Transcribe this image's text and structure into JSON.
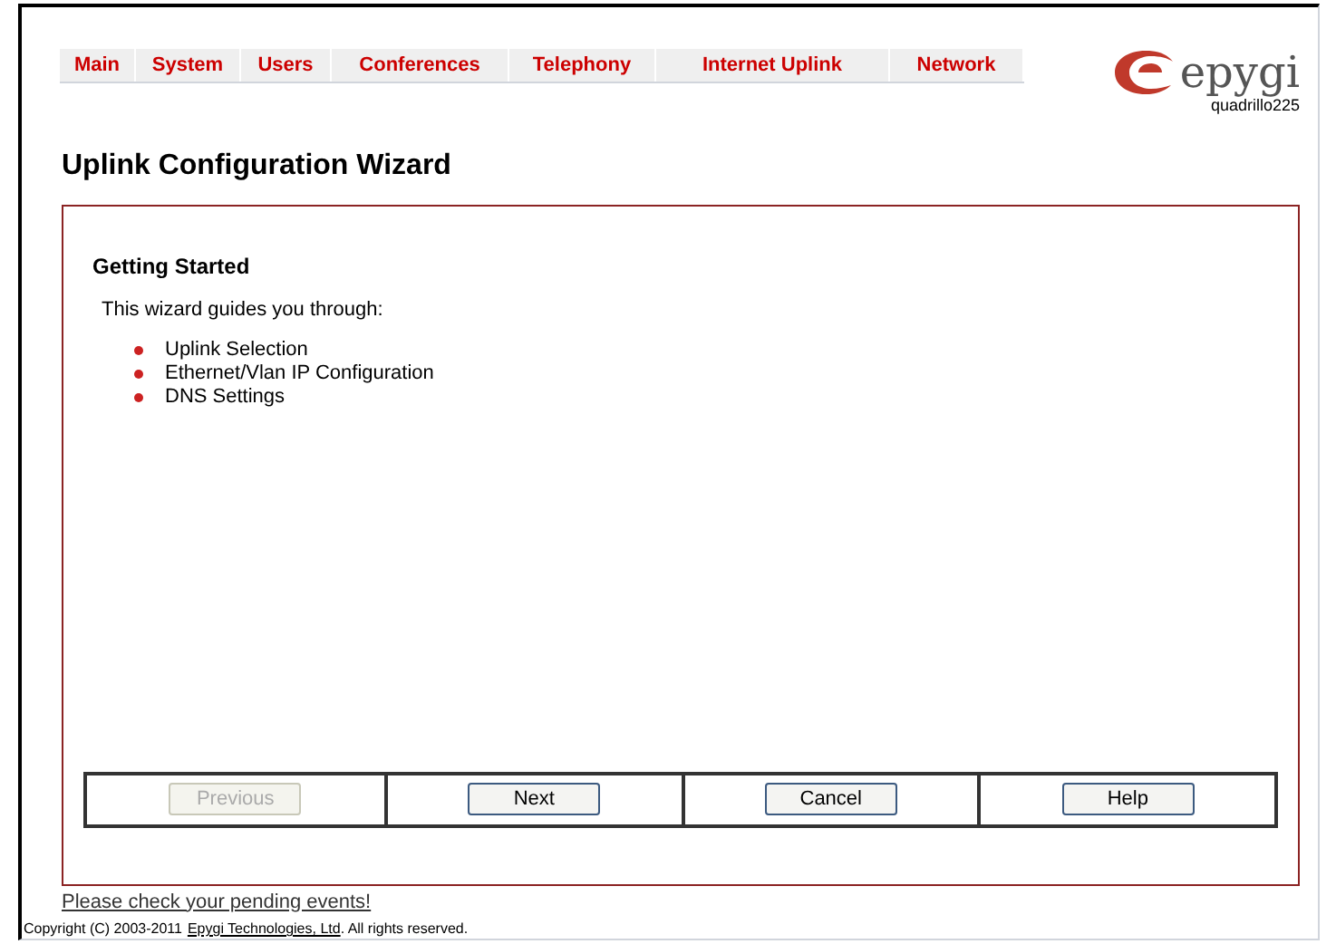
{
  "nav": [
    {
      "label": "Main"
    },
    {
      "label": "System"
    },
    {
      "label": "Users"
    },
    {
      "label": "Conferences"
    },
    {
      "label": "Telephony"
    },
    {
      "label": "Internet Uplink"
    },
    {
      "label": "Network"
    }
  ],
  "logo": {
    "brand": "epygi",
    "model": "quadrillo225"
  },
  "page_title": "Uplink Configuration Wizard",
  "wizard": {
    "heading": "Getting Started",
    "intro": "This wizard guides you through:",
    "steps": [
      "Uplink Selection",
      "Ethernet/Vlan IP Configuration",
      "DNS Settings"
    ],
    "buttons": [
      {
        "label": "Previous",
        "disabled": true
      },
      {
        "label": "Next",
        "disabled": false
      },
      {
        "label": "Cancel",
        "disabled": false
      },
      {
        "label": "Help",
        "disabled": false
      }
    ]
  },
  "events_link": "Please check your pending events!",
  "copyright": {
    "before": "Copyright (C) 2003-2011",
    "link": "Epygi Technologies, Ltd",
    "after": ". All rights reserved."
  }
}
